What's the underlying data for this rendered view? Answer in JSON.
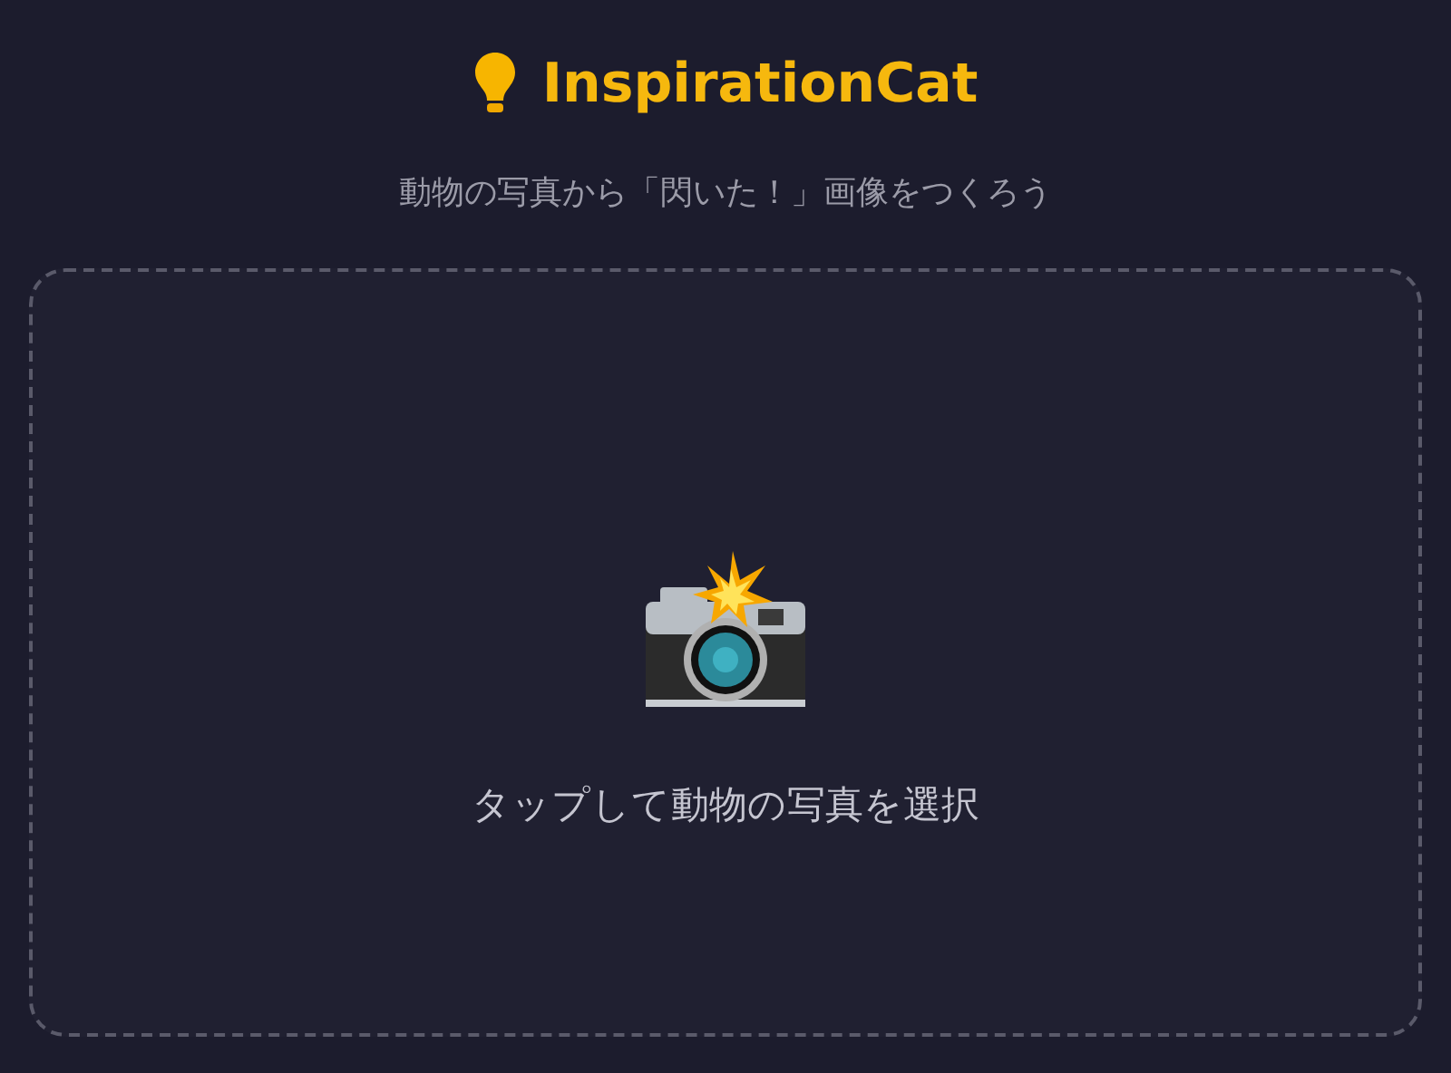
{
  "header": {
    "title": "InspirationCat",
    "subtitle": "動物の写真から「閃いた！」画像をつくろう"
  },
  "upload_area": {
    "prompt": "タップして動物の写真を選択"
  }
}
